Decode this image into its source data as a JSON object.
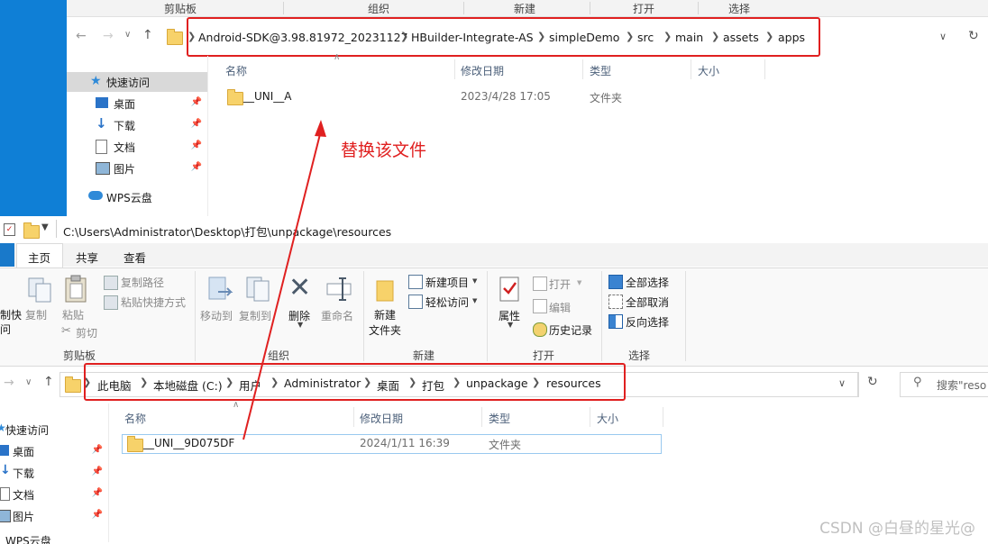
{
  "top_window": {
    "ribbon_groups": [
      "剪贴板",
      "组织",
      "新建",
      "打开",
      "选择"
    ],
    "breadcrumbs": [
      "Android-SDK@3.98.81972_20231127",
      "HBuilder-Integrate-AS",
      "simpleDemo",
      "src",
      "main",
      "assets",
      "apps"
    ],
    "sidebar": [
      {
        "label": "快速访问",
        "icon": "star-icon"
      },
      {
        "label": "桌面",
        "icon": "desktop-icon"
      },
      {
        "label": "下载",
        "icon": "download-icon"
      },
      {
        "label": "文档",
        "icon": "document-icon"
      },
      {
        "label": "图片",
        "icon": "picture-icon"
      },
      {
        "label": "WPS云盘",
        "icon": "cloud-icon"
      }
    ],
    "columns": [
      "名称",
      "修改日期",
      "类型",
      "大小"
    ],
    "files": [
      {
        "name": "__UNI__A",
        "date": "2023/4/28 17:05",
        "type": "文件夹",
        "size": ""
      }
    ]
  },
  "annotation": {
    "text": "替换该文件",
    "color": "#e02020"
  },
  "bottom_window": {
    "title_path": "C:\\Users\\Administrator\\Desktop\\打包\\unpackage\\resources",
    "tabs": [
      "主页",
      "共享",
      "查看"
    ],
    "ribbon": {
      "clipboard": {
        "cut_partial": "制快",
        "cut_partial2": "问",
        "copy": "复制",
        "paste": "粘贴",
        "copy_path": "复制路径",
        "paste_shortcut": "粘贴快捷方式",
        "cut": "剪切",
        "group": "剪贴板"
      },
      "organize": {
        "move_to": "移动到",
        "copy_to": "复制到",
        "delete": "删除",
        "rename": "重命名",
        "group": "组织"
      },
      "new": {
        "new_item": "新建项目",
        "easy_access": "轻松访问",
        "new_folder_line1": "新建",
        "new_folder_line2": "文件夹",
        "group": "新建"
      },
      "open": {
        "properties": "属性",
        "open": "打开",
        "edit": "编辑",
        "history": "历史记录",
        "group": "打开"
      },
      "select": {
        "select_all": "全部选择",
        "select_none": "全部取消",
        "invert": "反向选择",
        "group": "选择"
      }
    },
    "breadcrumbs": [
      "此电脑",
      "本地磁盘 (C:)",
      "用户",
      "Administrator",
      "桌面",
      "打包",
      "unpackage",
      "resources"
    ],
    "search_placeholder": "搜索\"reso",
    "sidebar": [
      {
        "label": "快速访问",
        "icon": "star-icon"
      },
      {
        "label": "桌面",
        "icon": "desktop-icon"
      },
      {
        "label": "下载",
        "icon": "download-icon"
      },
      {
        "label": "文档",
        "icon": "document-icon"
      },
      {
        "label": "图片",
        "icon": "picture-icon"
      },
      {
        "label": "WPS云盘",
        "icon": "cloud-icon"
      }
    ],
    "columns": [
      "名称",
      "修改日期",
      "类型",
      "大小"
    ],
    "files": [
      {
        "name": "__UNI__9D075DF",
        "date": "2024/1/11 16:39",
        "type": "文件夹",
        "size": ""
      }
    ]
  },
  "watermark": "CSDN @白昼的星光@",
  "colors": {
    "highlight_box": "#e02020",
    "accent": "#1979ca",
    "folder": "#f7d26a"
  }
}
